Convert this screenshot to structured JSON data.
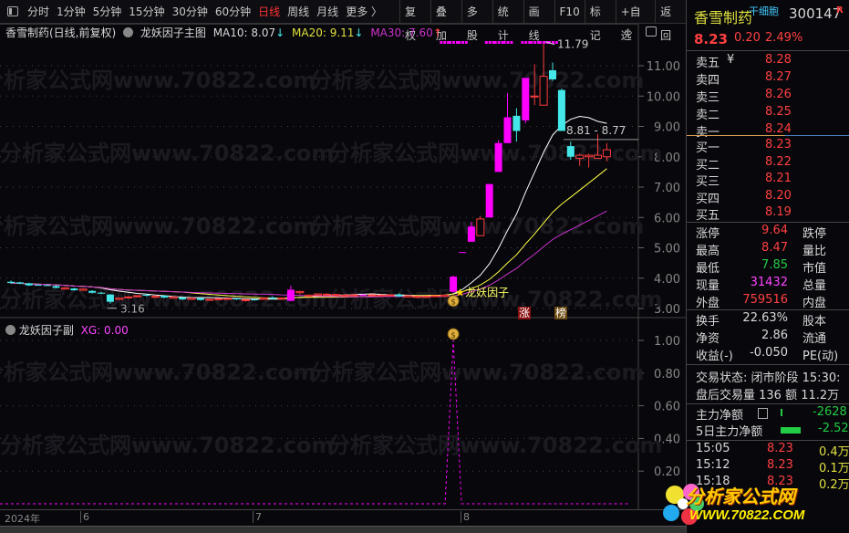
{
  "toolbar": {
    "periods": [
      "分时",
      "1分钟",
      "5分钟",
      "15分钟",
      "30分钟",
      "60分钟",
      "日线",
      "周线",
      "月线",
      "更多 〉"
    ],
    "active": "日线",
    "buttons": [
      "复权",
      "叠加",
      "多股",
      "统计",
      "画线",
      "F10",
      "标记",
      "+自选",
      "返回"
    ]
  },
  "main_header": {
    "title": "香雪制药(日线,前复权)",
    "indicator": "龙妖因子主图",
    "ma10": "MA10: 8.07",
    "ma20": "MA20: 9.11",
    "ma30": "MA30: 7.60",
    "arrow_down": "↓",
    "arrow_up": "↑"
  },
  "sub_header": {
    "indicator": "龙妖因子副",
    "xg": "XG: 0.00"
  },
  "annotations": {
    "high": "11.79",
    "low": "3.16",
    "current": "8.81 - 8.77",
    "signal": "龙妖因子",
    "tag1": "涨",
    "tag2": "榜"
  },
  "x_axis": [
    "2024年",
    "6",
    "7",
    "8"
  ],
  "colors": {
    "up": "#ff3b3b",
    "dragon": "#ff00ff",
    "down": "#44e8e8",
    "ma10": "#ffffff",
    "ma20": "#ffff44",
    "ma30": "#cc33cc"
  },
  "chart_data": [
    {
      "type": "candlestick",
      "title": "龙妖因子主图",
      "ylim": [
        2.7,
        12.3
      ],
      "yticks": [
        "3.00",
        "4.00",
        "5.00",
        "6.00",
        "7.00",
        "8.00",
        "9.00",
        "10.00",
        "11.00"
      ],
      "candles": [
        [
          3.88,
          3.92,
          3.82,
          3.84,
          "c"
        ],
        [
          3.86,
          3.88,
          3.8,
          3.82,
          "c"
        ],
        [
          3.83,
          3.85,
          3.74,
          3.76,
          "c"
        ],
        [
          3.78,
          3.8,
          3.76,
          3.78,
          "c"
        ],
        [
          3.77,
          3.79,
          3.75,
          3.77,
          "c"
        ],
        [
          3.74,
          3.76,
          3.66,
          3.68,
          "c"
        ],
        [
          3.64,
          3.7,
          3.62,
          3.68,
          "r"
        ],
        [
          3.66,
          3.68,
          3.58,
          3.6,
          "c"
        ],
        [
          3.6,
          3.66,
          3.58,
          3.64,
          "r"
        ],
        [
          3.58,
          3.6,
          3.5,
          3.52,
          "c"
        ],
        [
          3.52,
          3.54,
          3.48,
          3.5,
          "c"
        ],
        [
          3.46,
          3.48,
          3.16,
          3.22,
          "c"
        ],
        [
          3.3,
          3.36,
          3.28,
          3.34,
          "r"
        ],
        [
          3.36,
          3.4,
          3.32,
          3.38,
          "r"
        ],
        [
          3.4,
          3.44,
          3.36,
          3.42,
          "r"
        ],
        [
          3.45,
          3.48,
          3.4,
          3.42,
          "c"
        ],
        [
          3.4,
          3.44,
          3.36,
          3.4,
          "r"
        ],
        [
          3.42,
          3.44,
          3.34,
          3.36,
          "c"
        ],
        [
          3.34,
          3.4,
          3.32,
          3.38,
          "r"
        ],
        [
          3.36,
          3.38,
          3.28,
          3.3,
          "c"
        ],
        [
          3.3,
          3.36,
          3.28,
          3.34,
          "r"
        ],
        [
          3.34,
          3.36,
          3.26,
          3.28,
          "c"
        ],
        [
          3.28,
          3.32,
          3.26,
          3.3,
          "r"
        ],
        [
          3.3,
          3.34,
          3.28,
          3.32,
          "r"
        ],
        [
          3.32,
          3.34,
          3.3,
          3.33,
          "r"
        ],
        [
          3.33,
          3.35,
          3.28,
          3.3,
          "c"
        ],
        [
          3.26,
          3.3,
          3.22,
          3.29,
          "r"
        ],
        [
          3.3,
          3.32,
          3.26,
          3.28,
          "c"
        ],
        [
          3.3,
          3.36,
          3.28,
          3.34,
          "r"
        ],
        [
          3.36,
          3.4,
          3.3,
          3.32,
          "c"
        ],
        [
          3.32,
          3.36,
          3.28,
          3.34,
          "r"
        ],
        [
          3.25,
          3.75,
          3.24,
          3.62,
          "m"
        ],
        [
          3.52,
          3.58,
          3.46,
          3.56,
          "r"
        ],
        [
          3.4,
          3.46,
          3.38,
          3.44,
          "r"
        ],
        [
          3.44,
          3.5,
          3.42,
          3.48,
          "r"
        ],
        [
          3.46,
          3.5,
          3.44,
          3.47,
          "r"
        ],
        [
          3.45,
          3.48,
          3.43,
          3.46,
          "r"
        ],
        [
          3.44,
          3.46,
          3.4,
          3.43,
          "r"
        ],
        [
          3.43,
          3.46,
          3.4,
          3.45,
          "r"
        ],
        [
          3.45,
          3.47,
          3.42,
          3.44,
          "m"
        ],
        [
          3.44,
          3.46,
          3.42,
          3.45,
          "r"
        ],
        [
          3.43,
          3.46,
          3.4,
          3.44,
          "r"
        ],
        [
          3.44,
          3.46,
          3.42,
          3.45,
          "r"
        ],
        [
          3.46,
          3.5,
          3.38,
          3.4,
          "c"
        ],
        [
          3.42,
          3.44,
          3.36,
          3.38,
          "r"
        ],
        [
          3.38,
          3.42,
          3.34,
          3.4,
          "r"
        ],
        [
          3.38,
          3.41,
          3.36,
          3.4,
          "r"
        ],
        [
          3.4,
          3.44,
          3.38,
          3.42,
          "r"
        ],
        [
          3.4,
          3.46,
          3.38,
          3.44,
          "r"
        ],
        [
          3.55,
          4.08,
          3.52,
          4.05,
          "m"
        ],
        [
          4.84,
          4.86,
          4.84,
          4.86,
          "m"
        ],
        [
          5.2,
          5.85,
          5.2,
          5.7,
          "m"
        ],
        [
          5.4,
          6.05,
          5.4,
          5.95,
          "r"
        ],
        [
          6.0,
          7.1,
          6.0,
          7.1,
          "m"
        ],
        [
          7.5,
          8.55,
          7.5,
          8.45,
          "m"
        ],
        [
          8.45,
          10.1,
          8.45,
          9.3,
          "m"
        ],
        [
          9.35,
          9.6,
          8.5,
          8.85,
          "c"
        ],
        [
          9.2,
          10.6,
          9.1,
          10.6,
          "m"
        ],
        [
          9.98,
          11.05,
          9.7,
          10.0,
          "r"
        ],
        [
          9.7,
          11.79,
          9.7,
          10.65,
          "r"
        ],
        [
          10.85,
          11.1,
          10.5,
          10.55,
          "c"
        ],
        [
          10.2,
          10.25,
          8.85,
          8.85,
          "c"
        ],
        [
          8.35,
          8.5,
          7.9,
          8.0,
          "c"
        ],
        [
          7.95,
          8.1,
          7.7,
          8.05,
          "r"
        ],
        [
          8.0,
          8.1,
          7.65,
          8.05,
          "r"
        ],
        [
          7.95,
          8.75,
          7.95,
          8.05,
          "r"
        ],
        [
          8.0,
          8.45,
          7.85,
          8.23,
          "r"
        ]
      ],
      "ma_periods": [
        10,
        20,
        30
      ],
      "top_dots": [
        48,
        49,
        50,
        53,
        54,
        55,
        57,
        58,
        59,
        60
      ],
      "signal_index": 49
    },
    {
      "type": "line",
      "title": "龙妖因子副",
      "series": [
        {
          "name": "XG",
          "spike_index": 49,
          "spike_value": 1.0,
          "base": 0
        }
      ],
      "ylim": [
        0,
        1.1
      ],
      "yticks": [
        "0.20",
        "0.40",
        "0.60",
        "0.80",
        "1.00"
      ]
    }
  ],
  "quote": {
    "name": "香雪制药",
    "concept": "干细胞",
    "code": "300147",
    "badge": "R",
    "price": "8.23",
    "change": "0.20",
    "pct": "2.49%"
  },
  "order_book": {
    "asks": [
      {
        "label": "卖五",
        "price": "8.28"
      },
      {
        "label": "卖四",
        "price": "8.27"
      },
      {
        "label": "卖三",
        "price": "8.26"
      },
      {
        "label": "卖二",
        "price": "8.25"
      },
      {
        "label": "卖一",
        "price": "8.24"
      }
    ],
    "bids": [
      {
        "label": "买一",
        "price": "8.23"
      },
      {
        "label": "买二",
        "price": "8.22"
      },
      {
        "label": "买三",
        "price": "8.21"
      },
      {
        "label": "买四",
        "price": "8.20"
      },
      {
        "label": "买五",
        "price": "8.19"
      }
    ],
    "yen": "¥"
  },
  "stats": [
    {
      "l": "涨停",
      "v": "9.64",
      "r": "跌停"
    },
    {
      "l": "最高",
      "v": "8.47",
      "r": "量比"
    },
    {
      "l": "最低",
      "v": "7.85",
      "r": "市值"
    },
    {
      "l": "现量",
      "v": "31432",
      "r": "总量"
    },
    {
      "l": "外盘",
      "v": "759516",
      "r": "内盘"
    }
  ],
  "stats2": [
    {
      "l": "换手",
      "v": "22.63%",
      "r": "股本"
    },
    {
      "l": "净资",
      "v": "2.86",
      "r": "流通"
    },
    {
      "l": "收益(-)",
      "v": "-0.050",
      "r": "PE(动)"
    }
  ],
  "trade_status": "交易状态: 闭市阶段 15:30:",
  "after_hours": "盘后交易量 136 额 11.2万",
  "flow": [
    {
      "l": "主力净额",
      "v": "-2628"
    },
    {
      "l": "5日主力净额",
      "v": "-2.52"
    }
  ],
  "ticks": [
    {
      "t": "15:05",
      "p": "8.23",
      "v": "0.4万"
    },
    {
      "t": "15:12",
      "p": "8.23",
      "v": "0.1万"
    },
    {
      "t": "15:18",
      "p": "8.23",
      "v": "0.2万"
    }
  ],
  "logo": {
    "text": "分析家公式网",
    "url": "WWW.70822.COM"
  }
}
